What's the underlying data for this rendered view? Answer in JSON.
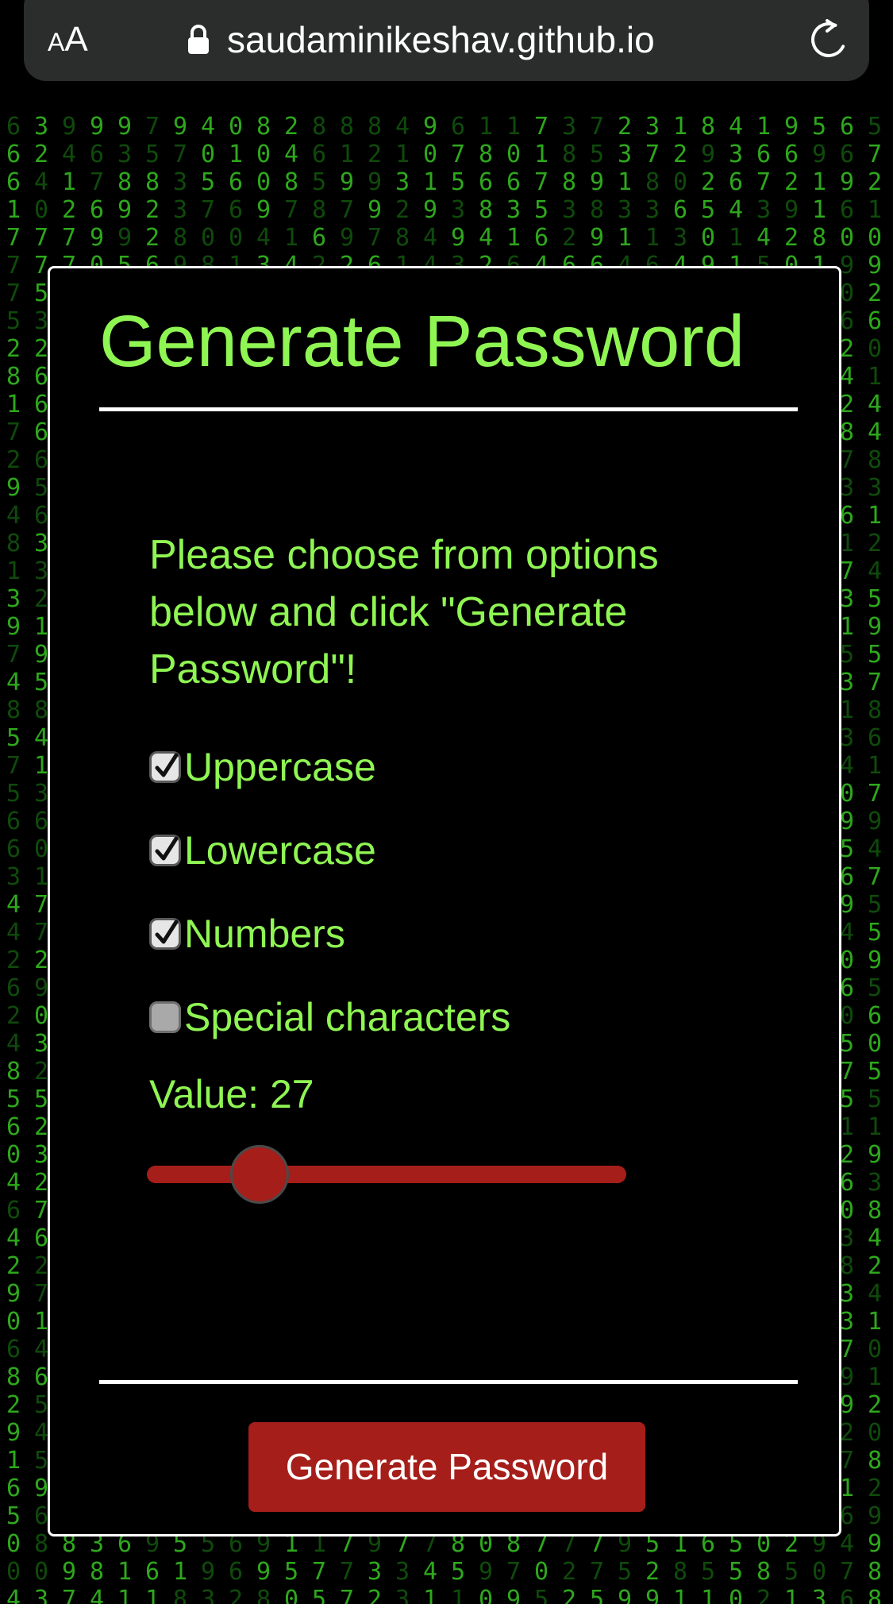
{
  "browser": {
    "text_size_small": "A",
    "text_size_large": "A",
    "url": "saudaminikeshav.github.io"
  },
  "card": {
    "title": "Generate Password",
    "instructions": "Please choose from options below and click \"Generate Password\"!",
    "options": [
      {
        "label": "Uppercase",
        "checked": true
      },
      {
        "label": "Lowercase",
        "checked": true
      },
      {
        "label": "Numbers",
        "checked": true
      },
      {
        "label": "Special characters",
        "checked": false
      }
    ],
    "value_label": "Value: ",
    "length_value": "27",
    "slider_fraction": 0.16,
    "button_label": "Generate Password"
  },
  "colors": {
    "accent_green": "#8ff553",
    "button_red": "#a61e1a",
    "matrix_green": "#2ea81c"
  }
}
